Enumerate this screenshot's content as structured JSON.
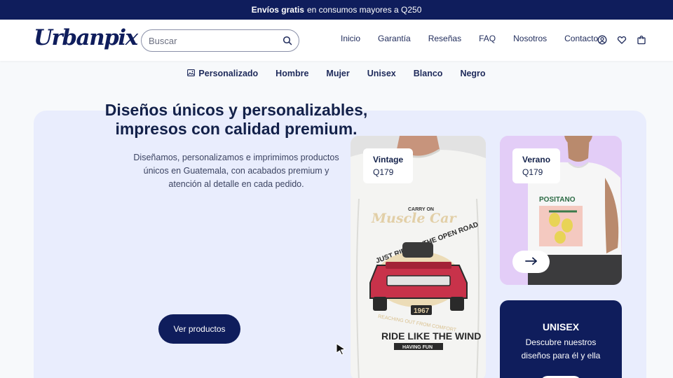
{
  "topbar": {
    "bold": "Envíos gratis",
    "rest": "en consumos mayores a Q250"
  },
  "header": {
    "logo": "Urbanpix",
    "search": {
      "placeholder": "Buscar",
      "value": "",
      "icon": "search-icon"
    },
    "nav": [
      "Inicio",
      "Garantía",
      "Reseñas",
      "FAQ",
      "Nosotros",
      "Contacto"
    ],
    "icons": [
      "user-icon",
      "heart-icon",
      "cart-icon"
    ]
  },
  "categories": [
    "Personalizado",
    "Hombre",
    "Mujer",
    "Unisex",
    "Blanco",
    "Negro"
  ],
  "hero": {
    "title_line1": "Diseños únicos y personalizables,",
    "title_line2": "impresos con calidad premium.",
    "description_line1": "Diseñamos, personalizamos e imprimimos productos",
    "description_line2": "únicos en Guatemala, con acabados premium y",
    "description_line3": "atención al detalle en cada pedido.",
    "button": "Ver productos"
  },
  "cards": {
    "vintage": {
      "name": "Vintage",
      "price": "Q179",
      "print": {
        "top": "CARRY ON",
        "brand": "Muscle Car",
        "slogan": "JUST RIDE TO THE OPEN ROAD",
        "year": "1967",
        "arc": "REACHING OUT FROM COMFORT",
        "bottom": "RIDE LIKE THE WIND",
        "sub": "HAVING FUN"
      }
    },
    "verano": {
      "name": "Verano",
      "price": "Q179",
      "print": "POSITANO",
      "arrow_icon": "arrow-right-icon"
    },
    "unisex": {
      "title": "UNISEX",
      "desc_line1": "Descubre nuestros",
      "desc_line2": "diseños para él y ella"
    }
  },
  "colors": {
    "navy": "#0f1d5c",
    "hero_bg": "#e9edfd",
    "verano_bg": "#e3cdf7"
  }
}
